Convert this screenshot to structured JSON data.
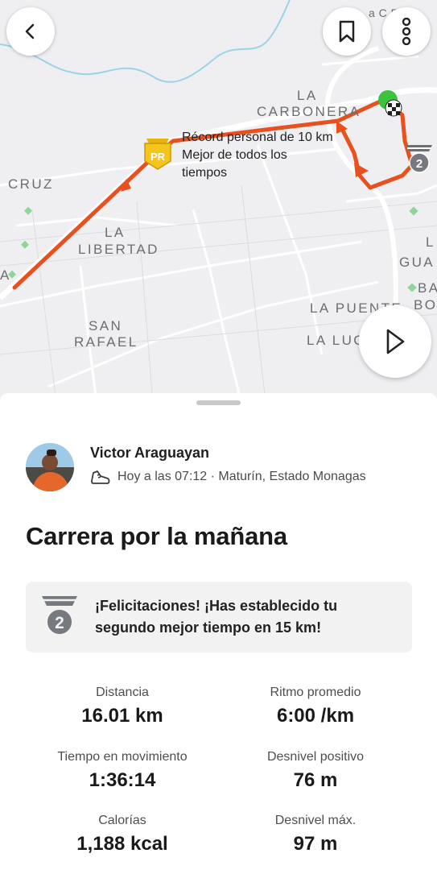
{
  "map": {
    "labels": {
      "la": "LA",
      "carbonera": "CARBONERA",
      "cruz": "CRUZ",
      "la_libertad_1": "LA",
      "la_libertad_2": "LIBERTAD",
      "san_rafael_1": "SAN",
      "san_rafael_2": "RAFAEL",
      "la_puente": "LA PUENTE",
      "la_luc": "LA LUC",
      "gua": "GUA",
      "bo": "BO",
      "ba": "BA",
      "l_right": "L",
      "a_left": "A",
      "ca_per": "a C  Per"
    },
    "pr_callout": {
      "line1": "Récord personal de 10 km",
      "line2": "Mejor de todos los",
      "line3": "tiempos"
    },
    "badges": {
      "pr": "PR",
      "second": "2"
    },
    "colors": {
      "route": "#e8511f",
      "start": "#3cc23c",
      "pr_badge": "#f5c41d",
      "medal_gray": "#76797d"
    }
  },
  "toolbar": {
    "back_icon": "chevron-left-icon",
    "bookmark_icon": "bookmark-icon",
    "more_icon": "more-vertical-icon",
    "play_icon": "play-icon"
  },
  "athlete": {
    "name": "Victor Araguayan",
    "meta": "Hoy a las 07:12 · Maturín, Estado Monagas"
  },
  "activity": {
    "title": "Carrera por la mañana"
  },
  "achievement": {
    "line1": "¡Felicitaciones! ¡Has establecido tu",
    "line2": "segundo mejor tiempo en 15 km!",
    "medal_number": "2"
  },
  "stats": [
    {
      "label": "Distancia",
      "value": "16.01 km"
    },
    {
      "label": "Ritmo promedio",
      "value": "6:00 /km"
    },
    {
      "label": "Tiempo en movimiento",
      "value": "1:36:14"
    },
    {
      "label": "Desnivel positivo",
      "value": "76 m"
    },
    {
      "label": "Calorías",
      "value": "1,188 kcal"
    },
    {
      "label": "Desnivel máx.",
      "value": "97 m"
    }
  ]
}
